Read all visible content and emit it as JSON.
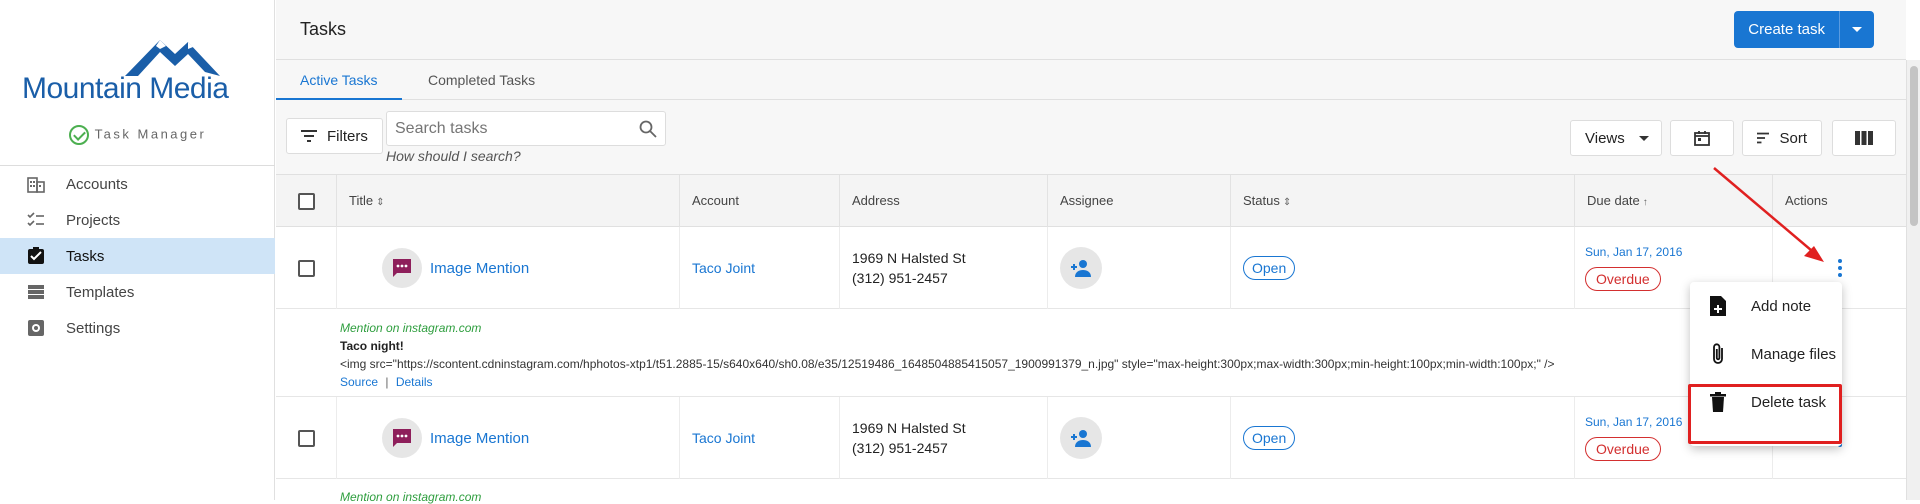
{
  "sidebar": {
    "brand": "Mountain Media",
    "app_name": "Task Manager",
    "items": [
      {
        "label": "Accounts",
        "icon": "building-icon"
      },
      {
        "label": "Projects",
        "icon": "checklist-icon"
      },
      {
        "label": "Tasks",
        "icon": "checkbox-icon",
        "active": true
      },
      {
        "label": "Templates",
        "icon": "table-icon"
      },
      {
        "label": "Settings",
        "icon": "gear-icon"
      }
    ]
  },
  "header": {
    "title": "Tasks",
    "create_label": "Create task"
  },
  "tabs": [
    "Active Tasks",
    "Completed Tasks"
  ],
  "toolbar": {
    "filters_label": "Filters",
    "search_placeholder": "Search tasks",
    "search_hint": "How should I search?",
    "views_label": "Views",
    "sort_label": "Sort"
  },
  "table": {
    "columns": [
      "Title",
      "Account",
      "Address",
      "Assignee",
      "Status",
      "Due date",
      "Actions"
    ],
    "rows": [
      {
        "title": "Image Mention",
        "account": "Taco Joint",
        "address_line1": "1969 N Halsted St",
        "address_line2": "(312) 951-2457",
        "status": "Open",
        "due_date": "Sun, Jan 17, 2016",
        "due_flag": "Overdue",
        "detail": {
          "source": "Mention on instagram.com",
          "title": "Taco night!",
          "body": "<img src=\"https://scontent.cdninstagram.com/hphotos-xtp1/t51.2885-15/s640x640/sh0.08/e35/12519486_1648504885415057_1900991379_n.jpg\" style=\"max-height:300px;max-width:300px;min-height:100px;min-width:100px;\" />",
          "link1": "Source",
          "separator": "|",
          "link2": "Details"
        }
      },
      {
        "title": "Image Mention",
        "account": "Taco Joint",
        "address_line1": "1969 N Halsted St",
        "address_line2": "(312) 951-2457",
        "status": "Open",
        "due_date": "Sun, Jan 17, 2016",
        "due_flag": "Overdue",
        "detail_source": "Mention on instagram.com"
      }
    ]
  },
  "action_menu": {
    "items": [
      "Add note",
      "Manage files",
      "Delete task"
    ]
  },
  "colors": {
    "accent": "#1976d2",
    "danger": "#d32f2f",
    "nav_active_bg": "#cfe4f7",
    "highlight": "#e02020"
  }
}
